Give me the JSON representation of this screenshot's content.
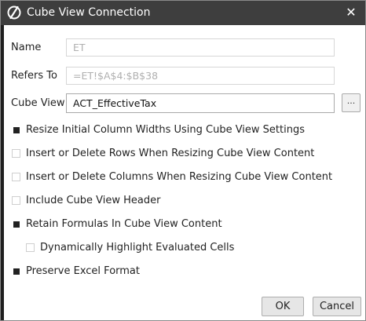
{
  "window": {
    "title": "Cube View Connection",
    "app_icon": "onestream-logo-icon",
    "close_glyph": "✕"
  },
  "form": {
    "name": {
      "label": "Name",
      "value": "ET"
    },
    "refers_to": {
      "label": "Refers To",
      "value": "=ET!$A$4:$B$38"
    },
    "cube_view": {
      "label": "Cube View",
      "value": "ACT_EffectiveTax",
      "browse_label": "..."
    }
  },
  "options": [
    {
      "label": "Resize Initial Column Widths Using Cube View Settings",
      "checked": true
    },
    {
      "label": "Insert or Delete Rows When Resizing Cube View Content",
      "checked": false
    },
    {
      "label": "Insert or Delete Columns When Resizing Cube View Content",
      "checked": false
    },
    {
      "label": "Include Cube View Header",
      "checked": false
    },
    {
      "label": "Retain Formulas In Cube View Content",
      "checked": true
    },
    {
      "label": "Dynamically Highlight Evaluated Cells",
      "checked": false
    },
    {
      "label": "Preserve Excel Format",
      "checked": true
    }
  ],
  "buttons": {
    "ok_label": "OK",
    "cancel_label": "Cancel"
  }
}
